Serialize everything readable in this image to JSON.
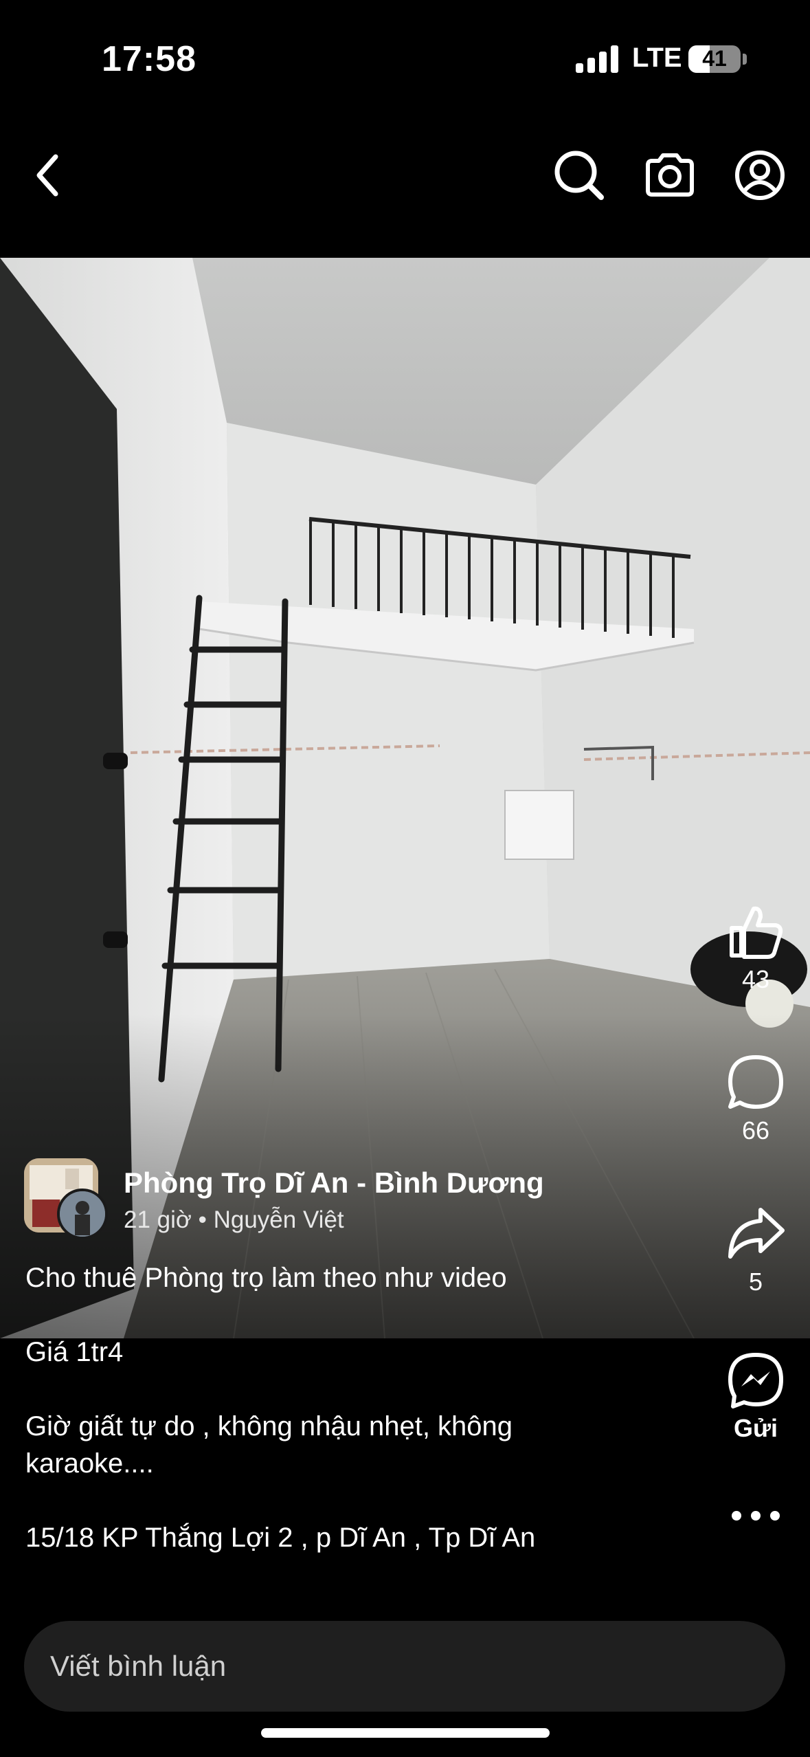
{
  "status_bar": {
    "time": "17:58",
    "network": "LTE",
    "battery": "41",
    "battery_level": 0.41
  },
  "nav": {
    "back_icon": "chevron-left-icon",
    "search_icon": "search-icon",
    "camera_icon": "camera-icon",
    "profile_icon": "profile-icon"
  },
  "actions": {
    "like": {
      "icon": "thumbs-up-icon",
      "count": "43"
    },
    "comment": {
      "icon": "comment-bubble-icon",
      "count": "66"
    },
    "share": {
      "icon": "share-arrow-icon",
      "count": "5"
    },
    "send": {
      "icon": "messenger-icon",
      "label": "Gửi"
    },
    "more": {
      "icon": "more-dots-icon"
    }
  },
  "post": {
    "page_name": "Phòng Trọ Dĩ An - Bình Dương",
    "time_ago": "21 giờ",
    "separator": "•",
    "author": "Nguyễn Việt",
    "caption": {
      "line1": "Cho thuê Phòng trọ làm theo như video",
      "line2": "Giá 1tr4",
      "line3": "Giờ giất tự do , không nhậu nhẹt, không karaoke....",
      "line4": "15/18 KP Thắng Lợi 2 , p Dĩ An , Tp Dĩ An"
    }
  },
  "comment": {
    "placeholder": "Viết bình luận"
  },
  "colors": {
    "background": "#000000",
    "input_bg": "#1f1f1f",
    "wall": "#e6e7e6",
    "floor": "#8c8b86"
  }
}
